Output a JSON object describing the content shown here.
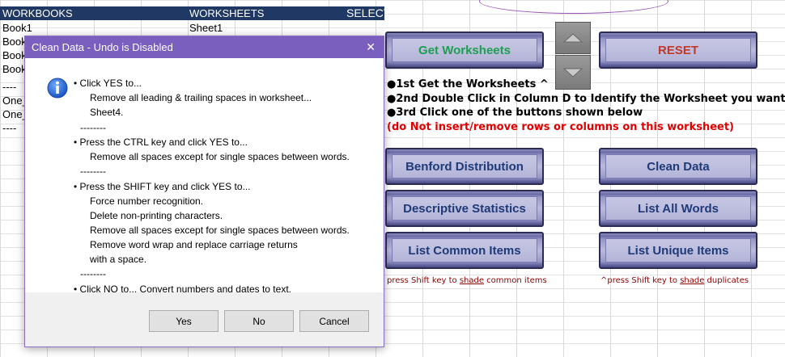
{
  "sheet": {
    "headers": {
      "workbooks": "WORKBOOKS",
      "worksheets": "WORKSHEETS",
      "select": "SELECT"
    },
    "rows": [
      {
        "workbook": "Book1",
        "worksheet": "Sheet1"
      },
      {
        "workbook": "Book",
        "worksheet": ""
      },
      {
        "workbook": "Book",
        "worksheet": ""
      },
      {
        "workbook": "Book",
        "worksheet": ""
      },
      {
        "workbook": "----",
        "worksheet": ""
      },
      {
        "workbook": "One_",
        "worksheet": ""
      },
      {
        "workbook": "One_",
        "worksheet": ""
      },
      {
        "workbook": "----",
        "worksheet": ""
      }
    ]
  },
  "buttons": {
    "get_worksheets": "Get Worksheets",
    "reset": "RESET",
    "benford": "Benford Distribution",
    "clean_data": "Clean Data",
    "descriptive": "Descriptive Statistics",
    "list_all_words": "List All Words",
    "list_common": "List Common Items",
    "list_unique": "List Unique Items"
  },
  "instructions": {
    "step1": "●1st  Get the Worksheets ^",
    "step2": "●2nd Double Click in Column D to Identify the Worksheet you want",
    "step3": "●3rd Click one of the buttons shown below",
    "warning": "(do Not insert/remove rows or columns on this worksheet)"
  },
  "notes": {
    "common_pre": "press Shift key to ",
    "common_u": "shade",
    "common_post": " common items",
    "unique_pre": "^press Shift key to ",
    "unique_u": "shade",
    "unique_post": " duplicates"
  },
  "colors": {
    "header_bg": "#1f3864",
    "button_text": "#1f3a78",
    "get_text": "#1e9e50",
    "reset_text": "#c0392b",
    "warning_text": "#e00000",
    "dialog_title_bg": "#7a5fbf"
  },
  "dialog": {
    "title": "Clean Data - Undo is Disabled",
    "close": "✕",
    "icon": "info-icon",
    "lines": [
      "• Click YES to...",
      "Remove all leading & trailing spaces in worksheet...",
      "Sheet4.",
      "--------",
      "• Press the CTRL key and click YES to...",
      "Remove all spaces except for single spaces between words.",
      "--------",
      "• Press the SHIFT key and click YES to...",
      "Force number recognition.",
      "Delete non-printing characters.",
      "Remove all spaces except for single spaces between words.",
      "Remove word wrap and replace carriage returns",
      "with a space.",
      "--------",
      "• Click NO to...  Convert numbers and dates to text."
    ],
    "yes": "Yes",
    "no": "No",
    "cancel": "Cancel"
  }
}
